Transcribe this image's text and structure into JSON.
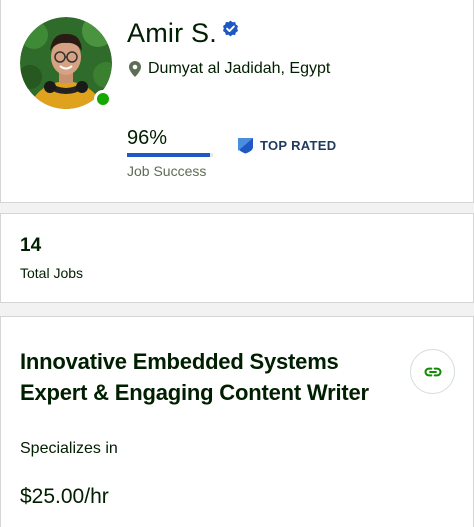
{
  "profile": {
    "name": "Amir S.",
    "location": "Dumyat al Jadidah, Egypt",
    "online": true,
    "job_success": {
      "percent_text": "96%",
      "value": 0.96,
      "label": "Job Success"
    },
    "badge": {
      "label": "TOP RATED",
      "icon": "top-rated-badge-icon"
    },
    "verified_icon": "verified-check-icon",
    "location_icon": "map-pin-icon"
  },
  "stats": {
    "total_jobs": {
      "value": "14",
      "label": "Total Jobs"
    }
  },
  "headline": {
    "title": "Innovative Embedded Systems Expert & Engaging Content Writer",
    "specializes_label": "Specializes in",
    "rate": "$25.00/hr",
    "share_icon": "link-icon"
  },
  "colors": {
    "brand_green": "#14a800",
    "verified_blue": "#1f57c3",
    "progress_blue": "#1f57c3",
    "badge_blue": "#1f3a5f",
    "text": "#001e00"
  }
}
